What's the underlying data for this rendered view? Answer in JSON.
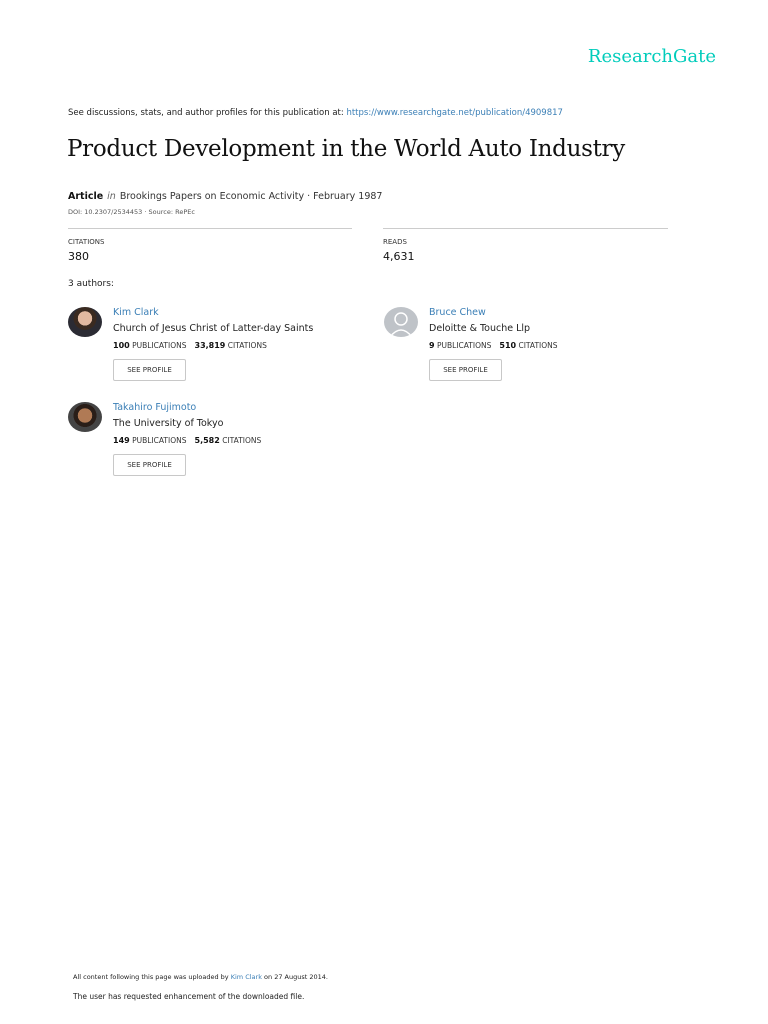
{
  "logo": "ResearchGate",
  "header": {
    "see_text": "See discussions, stats, and author profiles for this publication at:",
    "url": "https://www.researchgate.net/publication/4909817"
  },
  "title": "Product Development in the World Auto Industry",
  "meta": {
    "type": "Article",
    "in": "in",
    "journal": "Brookings Papers on Economic Activity · February 1987",
    "doi": "DOI: 10.2307/2534453 · Source: RePEc"
  },
  "stats": {
    "citations_label": "CITATIONS",
    "citations": "380",
    "reads_label": "READS",
    "reads": "4,631"
  },
  "authors_heading": "3 authors:",
  "authors": [
    {
      "name": "Kim Clark",
      "affiliation": "Church of Jesus Christ of Latter-day Saints",
      "publications": "100",
      "citations": "33,819",
      "pub_label": "Publications",
      "cit_label": "Citations",
      "button": "SEE PROFILE"
    },
    {
      "name": "Bruce Chew",
      "affiliation": "Deloitte & Touche Llp",
      "publications": "9",
      "citations": "510",
      "pub_label": "Publications",
      "cit_label": "Citations",
      "button": "SEE PROFILE"
    },
    {
      "name": "Takahiro Fujimoto",
      "affiliation": "The University of Tokyo",
      "publications": "149",
      "citations": "5,582",
      "pub_label": "Publications",
      "cit_label": "Citations",
      "button": "SEE PROFILE"
    }
  ],
  "footer": {
    "uploaded_prefix": "All content following this page was uploaded by",
    "uploader": "Kim Clark",
    "uploaded_suffix": "on 27 August 2014.",
    "note": "The user has requested enhancement of the downloaded file."
  }
}
